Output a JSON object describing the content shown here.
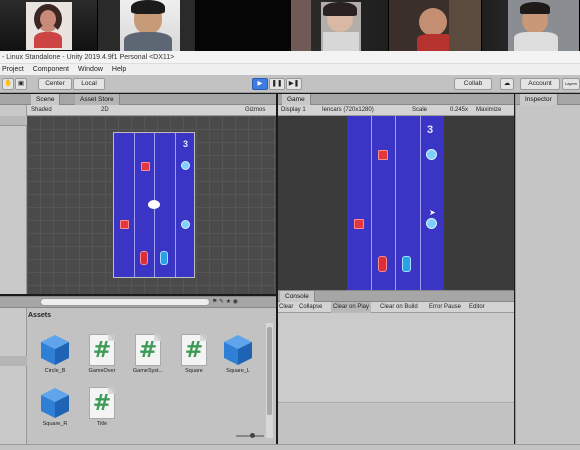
{
  "window": {
    "title": "- Linux Standalone - Unity 2019.4.9f1 Personal <DX11>"
  },
  "menu": [
    "Project",
    "Component",
    "Window",
    "Help"
  ],
  "toolbar": {
    "center_label": "Center",
    "local_label": "Local",
    "play_icon": "play-icon",
    "pause_icon": "pause-icon",
    "step_icon": "step-icon",
    "collab_label": "Collab",
    "account_label": "Account",
    "layers_label": "Layers",
    "layout_label": "Layout"
  },
  "scene_panel": {
    "tab_scene": "Scene",
    "tab_asset_store": "Asset Store",
    "shading_mode": "Shaded",
    "mode_2d": "2D",
    "gizmos_label": "Gizmos",
    "score": "3"
  },
  "game_panel": {
    "tab_game": "Game",
    "display": "Display 1",
    "resolution": "Iencars (720x1280)",
    "scale_label": "Scale",
    "scale_value": "0.245x",
    "maximize_label": "Maximize",
    "score": "3"
  },
  "inspector": {
    "tab_label": "Inspector"
  },
  "project_panel": {
    "assets_label": "Assets",
    "items": [
      {
        "name": "Circle_B",
        "icon": "prefab-cube-icon"
      },
      {
        "name": "GameOver",
        "icon": "script-icon"
      },
      {
        "name": "GameSyst...",
        "icon": "script-icon"
      },
      {
        "name": "Square",
        "icon": "script-icon"
      },
      {
        "name": "Square_L",
        "icon": "prefab-cube-icon"
      },
      {
        "name": "Square_R",
        "icon": "prefab-cube-icon"
      },
      {
        "name": "Title",
        "icon": "script-icon"
      }
    ]
  },
  "console": {
    "tab_label": "Console",
    "clear": "Clear",
    "collapse": "Collapse",
    "clear_on_play": "Clear on Play",
    "clear_on_build": "Clear on Build",
    "error_pause": "Error Pause",
    "editor": "Editor"
  },
  "colors": {
    "field_blue": "#3a35c4",
    "square_red": "#e3383b",
    "circle_cyan": "#7fd0ff",
    "play_active": "#3d7ce0",
    "script_hash": "#3d9b56",
    "cube_blue": "#2f7fd6"
  }
}
